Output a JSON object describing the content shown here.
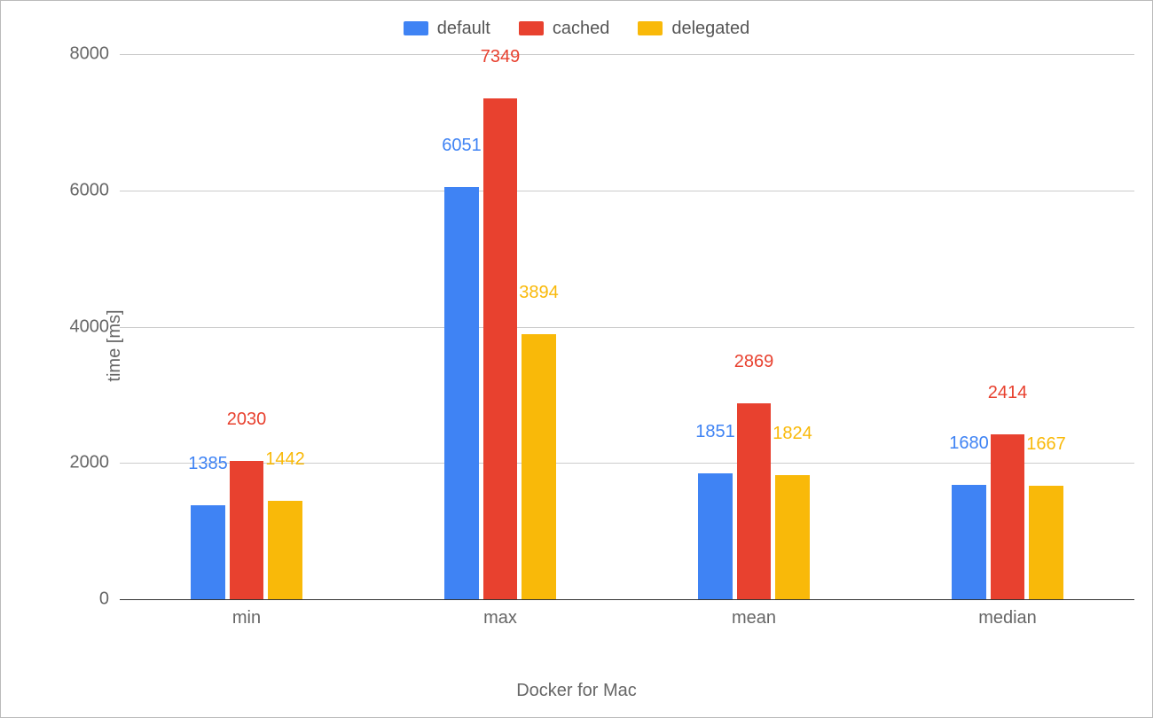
{
  "chart_data": {
    "type": "bar",
    "categories": [
      "min",
      "max",
      "mean",
      "median"
    ],
    "series": [
      {
        "name": "default",
        "color": "#3f83f4",
        "values": [
          1385,
          6051,
          1851,
          1680
        ]
      },
      {
        "name": "cached",
        "color": "#e8412f",
        "values": [
          2030,
          7349,
          2869,
          2414
        ]
      },
      {
        "name": "delegated",
        "color": "#f9b909",
        "values": [
          1442,
          3894,
          1824,
          1667
        ]
      }
    ],
    "xlabel": "Docker for Mac",
    "ylabel": "time [ms]",
    "ylim": [
      0,
      8000
    ],
    "yticks": [
      0,
      2000,
      4000,
      6000,
      8000
    ],
    "title": ""
  }
}
